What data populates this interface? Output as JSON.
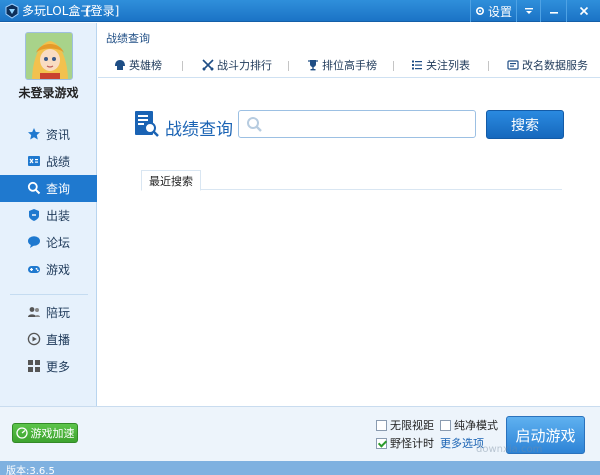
{
  "titlebar": {
    "title": "多玩LOL盒子",
    "login": "[登录]",
    "settings": "设置"
  },
  "sidebar": {
    "username": "未登录游戏",
    "nav": [
      {
        "label": "资讯",
        "icon": "star-icon"
      },
      {
        "label": "战绩",
        "icon": "record-icon"
      },
      {
        "label": "查询",
        "icon": "search-icon"
      },
      {
        "label": "出装",
        "icon": "gear-equip-icon"
      },
      {
        "label": "论坛",
        "icon": "chat-bubble-icon"
      },
      {
        "label": "游戏",
        "icon": "gamepad-icon"
      }
    ],
    "extra": [
      {
        "label": "陪玩",
        "icon": "people-icon"
      },
      {
        "label": "直播",
        "icon": "play-circle-icon"
      },
      {
        "label": "更多",
        "icon": "grid-icon"
      }
    ]
  },
  "main": {
    "breadcrumb": "战绩查询",
    "subnav": [
      "英雄榜",
      "战斗力排行",
      "排位高手榜",
      "关注列表",
      "改名数据服务"
    ],
    "search_title": "战绩查询",
    "search_placeholder": "",
    "search_button": "搜索",
    "recent_tab": "最近搜索"
  },
  "footer": {
    "accelerate": "游戏加速",
    "options": [
      {
        "label": "无限视距",
        "checked": false
      },
      {
        "label": "纯净模式",
        "checked": false
      },
      {
        "label": "野怪计时",
        "checked": true
      }
    ],
    "more_options": "更多选项",
    "launch": "启动游戏",
    "version": "版本:3.6.5",
    "watermark": "downxia.com"
  },
  "colors": {
    "accent": "#1f79cf",
    "titlebar": "#2f8fdb",
    "sidebar_bg": "#e6f1fc",
    "accelerate_green": "#4bb53b"
  }
}
